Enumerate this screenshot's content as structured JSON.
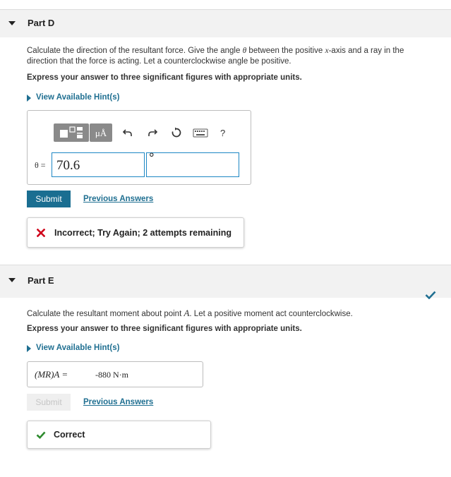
{
  "partD": {
    "title": "Part D",
    "question_line1_a": "Calculate the direction of the resultant force. Give the angle ",
    "theta": "θ",
    "question_line1_b": " between the positive ",
    "x": "x",
    "question_line1_c": "-axis and a ray in the",
    "question_line2": "direction that the force is acting. Let a counterclockwise angle be positive.",
    "instruction": "Express your answer to three significant figures with appropriate units.",
    "hint_label": "View Available Hint(s)",
    "toolbar": {
      "mu_label": "μÅ",
      "help_label": "?"
    },
    "answer_label": "θ =",
    "answer_value": "70.6",
    "unit_value": "°",
    "submit_label": "Submit",
    "previous_answers_label": "Previous Answers",
    "feedback": "Incorrect; Try Again; 2 attempts remaining",
    "feedback_color": "#d0021b"
  },
  "partE": {
    "title": "Part E",
    "question_a": "Calculate the resultant moment about point ",
    "point": "A",
    "question_b": ". Let a positive moment act counterclockwise.",
    "instruction": "Express your answer to three significant figures with appropriate units.",
    "hint_label": "View Available Hint(s)",
    "answer_label": "(MR)A =",
    "answer_value": "-880 N·m",
    "submit_label": "Submit",
    "previous_answers_label": "Previous Answers",
    "feedback": "Correct",
    "correct_color": "#2e8b2e"
  }
}
